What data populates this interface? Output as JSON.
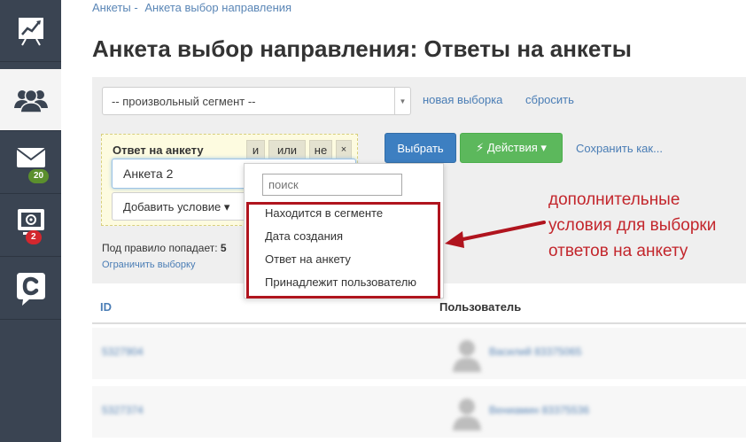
{
  "breadcrumbs": [
    "Анкеты -",
    "Анкета выбор направления"
  ],
  "page_title": "Анкета выбор направления: Ответы на анкеты",
  "sidebar": {
    "mail_badge": "20",
    "campaigns_badge": "2"
  },
  "filter": {
    "segment_value": "-- произвольный сегмент --",
    "new_selection_link": "новая выборка",
    "reset_link": "сбросить",
    "condition_label": "Ответ на анкету",
    "logic_and": "и",
    "logic_or": "или",
    "logic_not": "не",
    "logic_remove": "×",
    "condition_value": "Анкета 2",
    "add_condition": "Добавить условие ▾",
    "select_button": "Выбрать",
    "actions_button": "⚡ Действия ▾",
    "save_as_link": "Сохранить как...",
    "hint_prefix": "Под правило попадает:",
    "hint_count": "5",
    "limit_link": "Ограничить выборку"
  },
  "dropdown": {
    "search_placeholder": "поиск",
    "items": [
      "Находится в сегменте",
      "Дата создания",
      "Ответ на анкету",
      "Принадлежит пользователю"
    ]
  },
  "annotation": [
    "дополнительные",
    "условия для выборки",
    "ответов на анкету"
  ],
  "table": {
    "col_id": "ID",
    "col_user": "Пользователь",
    "rows": [
      {
        "id": "5327904",
        "user": "Василий 83375065"
      },
      {
        "id": "5327374",
        "user": "Вениамин 83375536"
      }
    ]
  },
  "colors": {
    "sidebar": "#3a4452",
    "link": "#4a7db5",
    "primary": "#3d7fc1",
    "success": "#5cb85c",
    "annotation": "#c3262c"
  }
}
